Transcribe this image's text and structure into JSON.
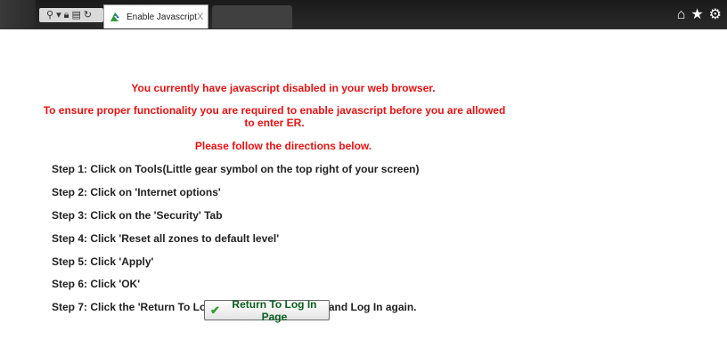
{
  "browser": {
    "tab_title": "Enable Javascript",
    "tab_close": "X",
    "toolbar_icons": [
      "search-icon",
      "dropdown-icon",
      "lock-icon",
      "compat-icon",
      "refresh-icon"
    ],
    "right_icons": [
      "home-icon",
      "star-icon",
      "gear-icon"
    ]
  },
  "warning": {
    "line1": "You currently have javascript disabled in your web browser.",
    "line2": "To ensure proper functionality you are required to enable javascript before you are allowed to enter ER.",
    "line3": "Please follow the directions below."
  },
  "steps": [
    "Step 1: Click on Tools(Little gear symbol on the top right of your screen)",
    "Step 2: Click on 'Internet options'",
    "Step 3: Click on the 'Security' Tab",
    "Step 4: Click 'Reset all zones to default level'",
    "Step 5: Click 'Apply'",
    "Step 6: Click 'OK'",
    "Step 7: Click the 'Return To Log In Page' button below and Log In again."
  ],
  "return_button": {
    "label": "Return To Log In Page"
  },
  "colors": {
    "warning": "#ee1111",
    "button_text": "#0b5f1e"
  }
}
